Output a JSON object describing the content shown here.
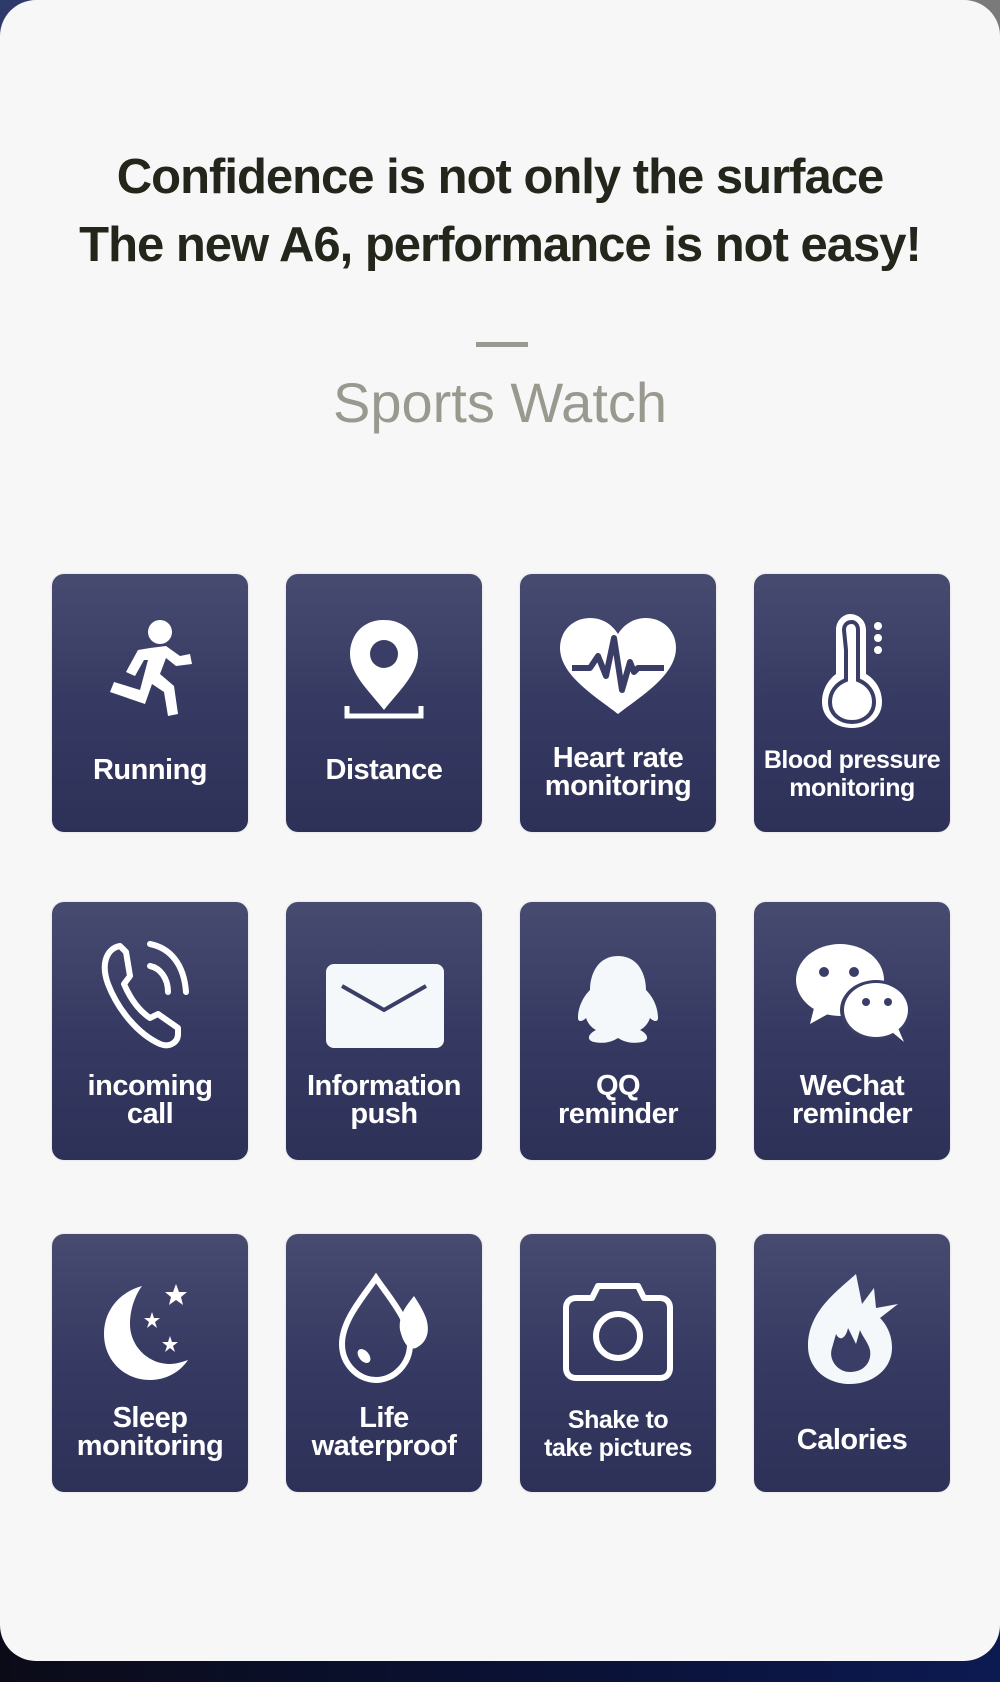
{
  "headline": {
    "line1": "Confidence is not only the surface",
    "line2": "The new A6, performance is not easy!"
  },
  "subtitle": "Sports Watch",
  "features": [
    {
      "icon": "running-icon",
      "line1": "Running",
      "line2": ""
    },
    {
      "icon": "location-pin-icon",
      "line1": "Distance",
      "line2": ""
    },
    {
      "icon": "heart-rate-icon",
      "line1": "Heart rate",
      "line2": "monitoring"
    },
    {
      "icon": "thermometer-icon",
      "line1": "Blood pressure",
      "line2": "monitoring"
    },
    {
      "icon": "phone-call-icon",
      "line1": "incoming",
      "line2": "call"
    },
    {
      "icon": "envelope-icon",
      "line1": "Information",
      "line2": "push"
    },
    {
      "icon": "qq-penguin-icon",
      "line1": "QQ",
      "line2": "reminder"
    },
    {
      "icon": "wechat-icon",
      "line1": "WeChat",
      "line2": "reminder"
    },
    {
      "icon": "moon-stars-icon",
      "line1": "Sleep",
      "line2": "monitoring"
    },
    {
      "icon": "water-drop-icon",
      "line1": "Life",
      "line2": "waterproof"
    },
    {
      "icon": "camera-icon",
      "line1": "Shake to",
      "line2": "take pictures"
    },
    {
      "icon": "flame-icon",
      "line1": "Calories",
      "line2": ""
    }
  ],
  "colors": {
    "tile_top": "#474b70",
    "tile_bottom": "#2d3158",
    "headline": "#23261a",
    "subtitle": "#9a998f",
    "card": "#f7f7f7"
  }
}
